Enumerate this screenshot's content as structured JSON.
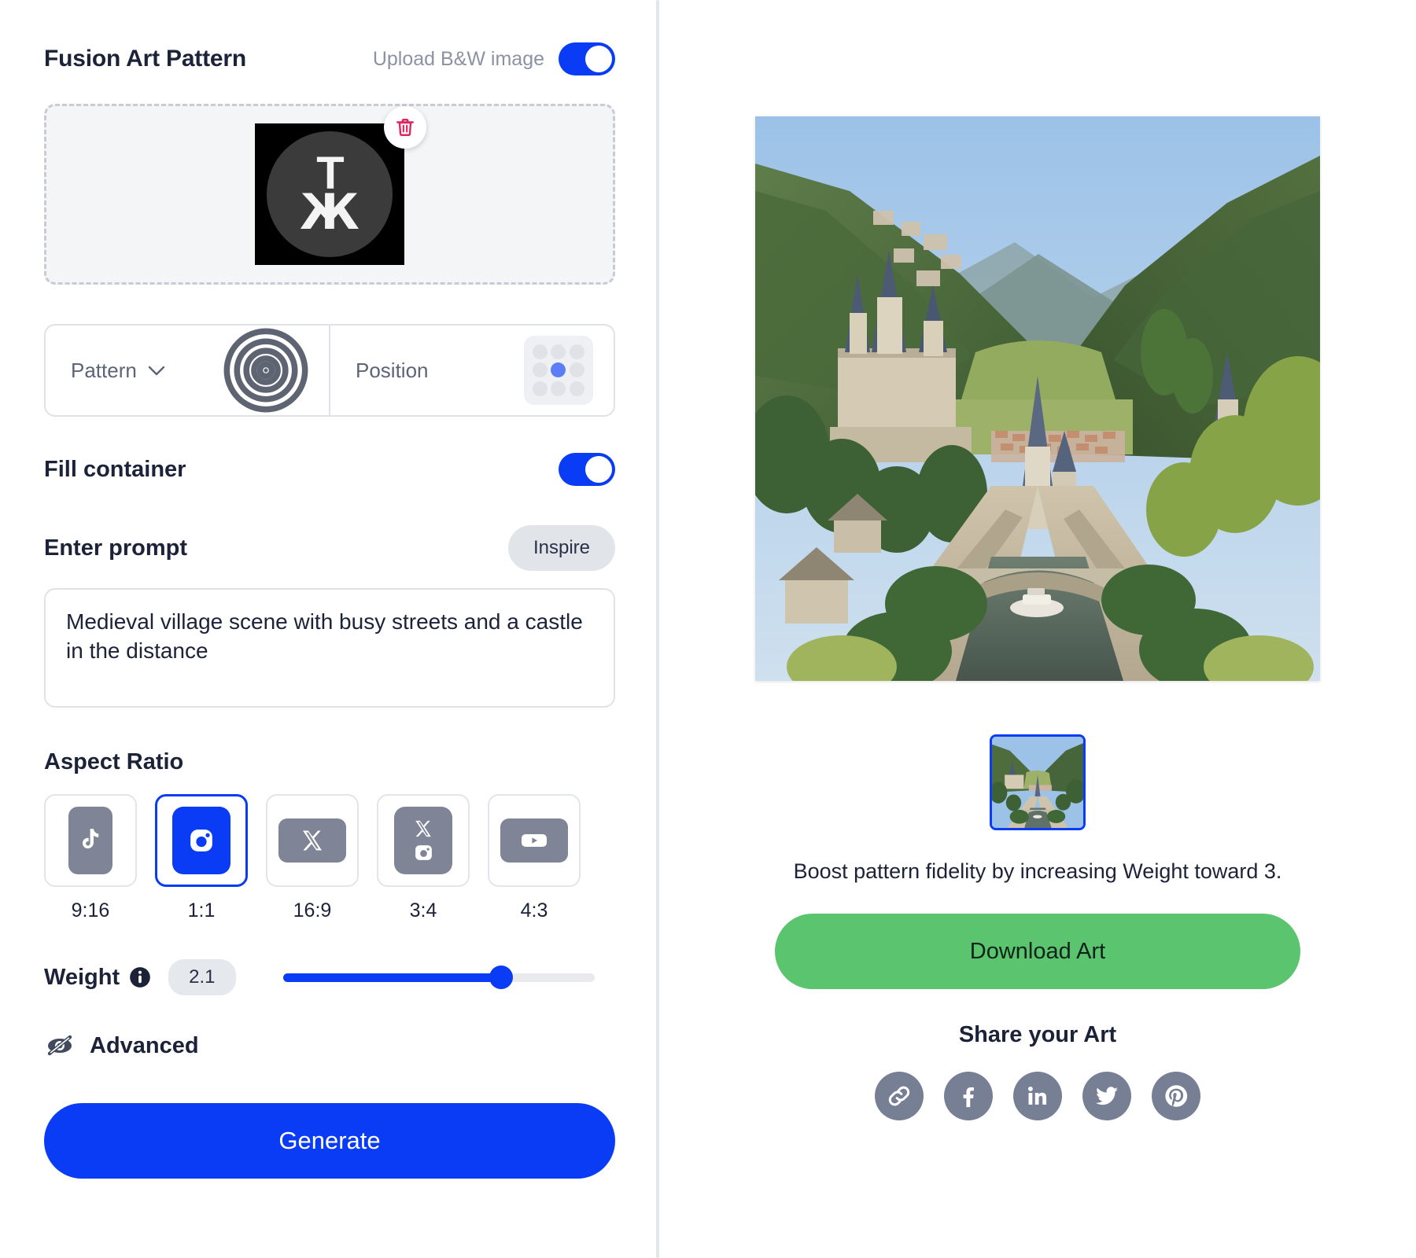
{
  "left": {
    "title": "Fusion Art Pattern",
    "upload_label": "Upload B&W image",
    "upload_toggle_state": "on",
    "uploaded_image": {
      "alt": "T Ж logo",
      "letter_top": "T",
      "letter_bottom": "Ж"
    },
    "delete_icon": "trash-icon",
    "pattern": {
      "label": "Pattern",
      "icon": "spiral-pattern-icon"
    },
    "position": {
      "label": "Position",
      "selected_cell": "center"
    },
    "fill_container": {
      "label": "Fill container",
      "state": "on"
    },
    "prompt": {
      "label": "Enter prompt",
      "inspire_label": "Inspire",
      "value": "Medieval village scene with busy streets and a castle in the distance",
      "placeholder": "Enter prompt"
    },
    "aspect_ratio": {
      "title": "Aspect Ratio",
      "options": [
        {
          "label": "9:16",
          "icon": "tiktok-icon",
          "shape": "tall",
          "selected": false
        },
        {
          "label": "1:1",
          "icon": "instagram-icon",
          "shape": "square",
          "selected": true
        },
        {
          "label": "16:9",
          "icon": "x-twitter-icon",
          "shape": "wide",
          "selected": false
        },
        {
          "label": "3:4",
          "icon": "x-instagram-icon",
          "shape": "square",
          "selected": false
        },
        {
          "label": "4:3",
          "icon": "youtube-icon",
          "shape": "wide",
          "selected": false
        }
      ]
    },
    "weight": {
      "label": "Weight",
      "value": "2.1",
      "info_icon": "info-icon",
      "percent": 70,
      "min": 0,
      "max": 3
    },
    "advanced": {
      "label": "Advanced",
      "icon": "eye-off-icon"
    },
    "generate_label": "Generate"
  },
  "right": {
    "artwork_alt": "Medieval village with castle in a green valley and river",
    "thumbnail_alt": "Generated art thumbnail",
    "hint": "Boost pattern fidelity by increasing Weight toward 3.",
    "download_label": "Download Art",
    "share_title": "Share your Art",
    "share_icons": [
      {
        "name": "link-icon"
      },
      {
        "name": "facebook-icon"
      },
      {
        "name": "linkedin-icon"
      },
      {
        "name": "twitter-icon"
      },
      {
        "name": "pinterest-icon"
      }
    ]
  },
  "colors": {
    "accent_blue": "#0a3cf5",
    "download_green": "#5bc46e",
    "icon_gray": "#7f8596",
    "text_dark": "#1c2238",
    "muted": "#8b92a3"
  }
}
